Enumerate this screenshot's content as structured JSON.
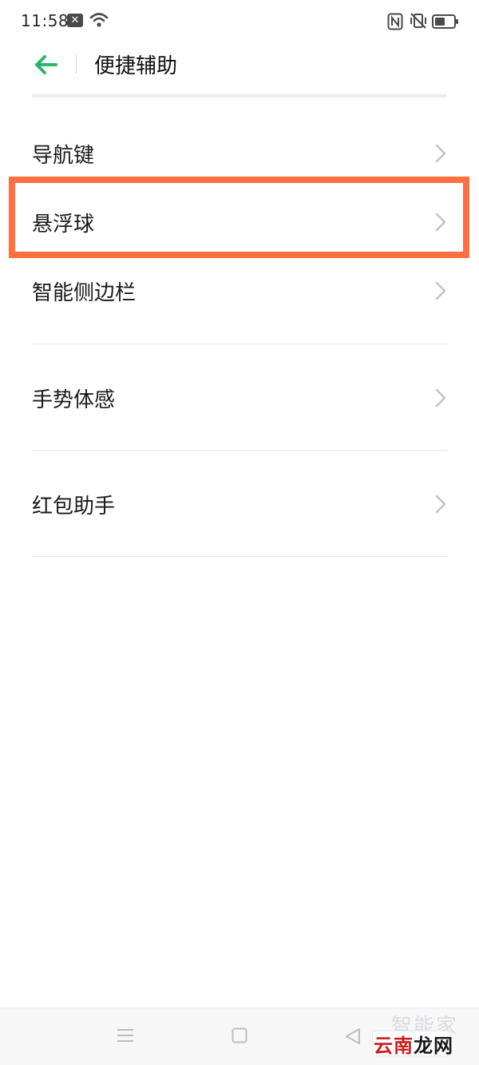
{
  "status_bar": {
    "time": "11:58",
    "icons": [
      "notification-x-icon",
      "wifi-icon",
      "nfc-icon",
      "vibrate-off-icon",
      "battery-icon"
    ]
  },
  "header": {
    "title": "便捷辅助",
    "back_icon": "arrow-left-icon",
    "accent_color": "#2bb56d"
  },
  "list": {
    "items": [
      {
        "label": "导航键"
      },
      {
        "label": "悬浮球",
        "highlighted": true
      },
      {
        "label": "智能侧边栏"
      },
      {
        "label": "手势体感"
      },
      {
        "label": "红包助手"
      }
    ]
  },
  "highlight_color": "#ff6f3f",
  "nav_bar": {
    "buttons": [
      "menu-icon",
      "home-icon",
      "back-triangle-icon"
    ]
  },
  "watermark": {
    "top": "智能家",
    "bottom_red": "云南",
    "bottom_dark": "龙网"
  }
}
